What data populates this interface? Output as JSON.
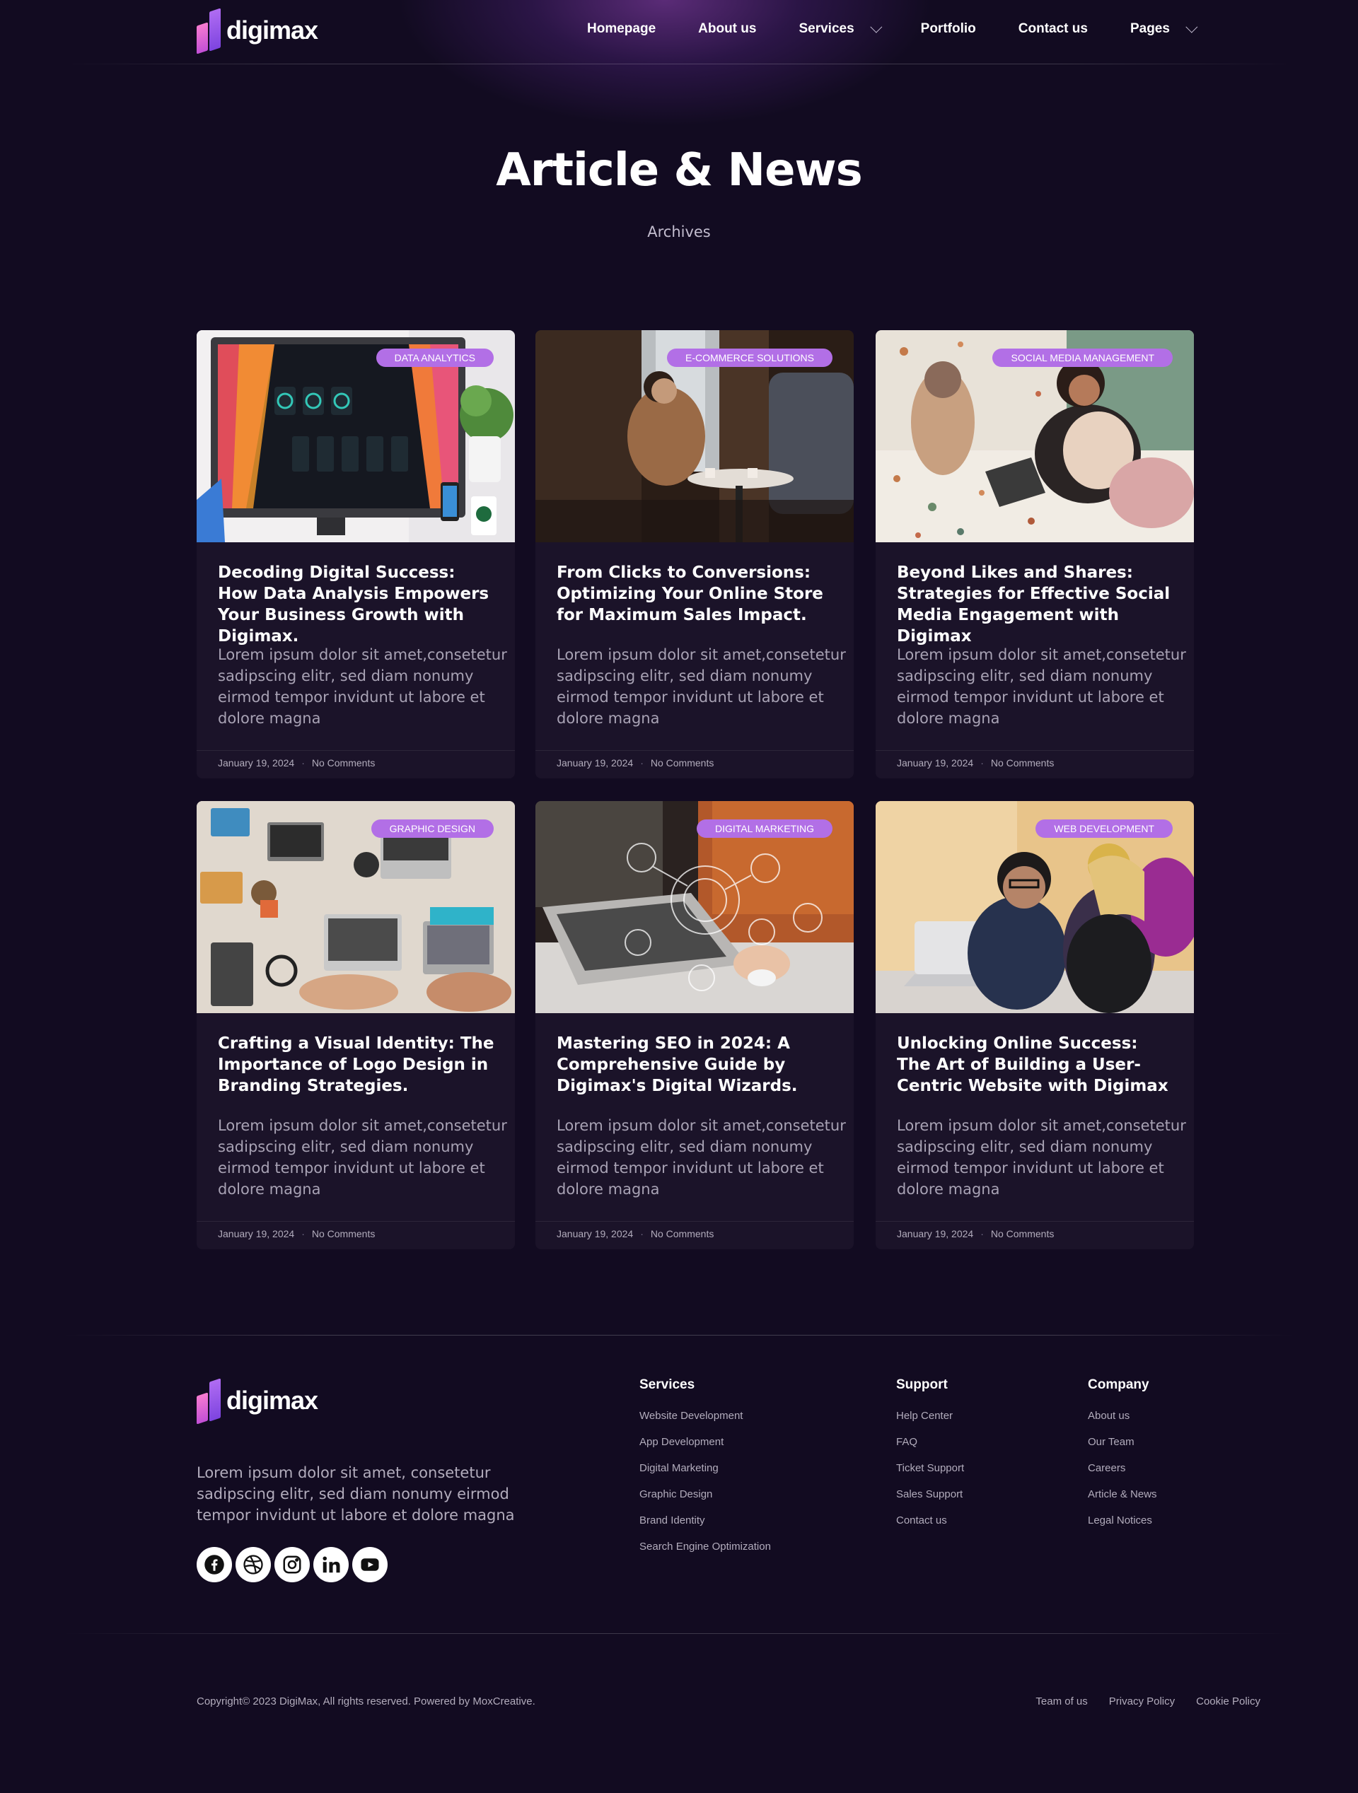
{
  "brand": {
    "name": "digimax"
  },
  "nav": {
    "items": [
      {
        "label": "Homepage",
        "has_dropdown": false
      },
      {
        "label": "About us",
        "has_dropdown": false
      },
      {
        "label": "Services",
        "has_dropdown": true
      },
      {
        "label": "Portfolio",
        "has_dropdown": false
      },
      {
        "label": "Contact us",
        "has_dropdown": false
      },
      {
        "label": "Pages",
        "has_dropdown": true
      }
    ]
  },
  "hero": {
    "title": "Article & News",
    "subtitle": "Archives"
  },
  "articles": [
    {
      "tag": "DATA ANALYTICS",
      "title": "Decoding Digital Success: How Data Analysis Empowers Your Business Growth with Digimax.",
      "excerpt": "Lorem ipsum dolor sit amet,consetetur sadipscing elitr, sed diam nonumy eirmod tempor invidunt ut labore et dolore magna",
      "date": "January 19, 2024",
      "comments": "No Comments",
      "image": "computer-monitor-dashboard-photo"
    },
    {
      "tag": "E-COMMERCE SOLUTIONS",
      "title": "From Clicks to Conversions: Optimizing Your Online Store for Maximum Sales Impact.",
      "excerpt": "Lorem ipsum dolor sit amet,consetetur sadipscing elitr, sed diam nonumy eirmod tempor invidunt ut labore et dolore magna",
      "date": "January 19, 2024",
      "comments": "No Comments",
      "image": "woman-in-cafe-photo"
    },
    {
      "tag": "SOCIAL MEDIA MANAGEMENT",
      "title": "Beyond Likes and Shares: Strategies for Effective Social Media Engagement with Digimax",
      "excerpt": "Lorem ipsum dolor sit amet,consetetur sadipscing elitr, sed diam nonumy eirmod tempor invidunt ut labore et dolore magna",
      "date": "January 19, 2024",
      "comments": "No Comments",
      "image": "women-working-laptop-photo"
    },
    {
      "tag": "GRAPHIC DESIGN",
      "title": "Crafting a Visual Identity: The Importance of Logo Design in Branding Strategies.",
      "excerpt": "Lorem ipsum dolor sit amet,consetetur sadipscing elitr, sed diam nonumy eirmod tempor invidunt ut labore et dolore magna",
      "date": "January 19, 2024",
      "comments": "No Comments",
      "image": "desk-with-laptops-photo"
    },
    {
      "tag": "DIGITAL MARKETING",
      "title": "Mastering SEO in 2024: A Comprehensive Guide by Digimax's Digital Wizards.",
      "excerpt": "Lorem ipsum dolor sit amet,consetetur sadipscing elitr, sed diam nonumy eirmod tempor invidunt ut labore et dolore magna",
      "date": "January 19, 2024",
      "comments": "No Comments",
      "image": "laptop-with-network-icons-photo"
    },
    {
      "tag": "WEB DEVELOPMENT",
      "title": "Unlocking Online Success: The Art of Building a User-Centric Website with Digimax",
      "excerpt": "Lorem ipsum dolor sit amet,consetetur sadipscing elitr, sed diam nonumy eirmod tempor invidunt ut labore et dolore magna",
      "date": "January 19, 2024",
      "comments": "No Comments",
      "image": "team-around-laptop-photo"
    }
  ],
  "footer": {
    "description": "Lorem ipsum dolor sit amet, consetetur sadipscing elitr, sed diam nonumy eirmod tempor invidunt ut labore et dolore magna",
    "socials": [
      "facebook-icon",
      "dribbble-icon",
      "instagram-icon",
      "linkedin-icon",
      "youtube-icon"
    ],
    "columns": [
      {
        "title": "Services",
        "links": [
          "Website Development",
          "App Development",
          "Digital Marketing",
          "Graphic Design",
          "Brand Identity",
          "Search Engine Optimization"
        ]
      },
      {
        "title": "Support",
        "links": [
          "Help Center",
          "FAQ",
          "Ticket Support",
          "Sales Support",
          "Contact us"
        ]
      },
      {
        "title": "Company",
        "links": [
          "About us",
          "Our Team",
          "Careers",
          "Article & News",
          "Legal Notices"
        ]
      }
    ],
    "copyright": "Copyright© 2023 DigiMax, All rights reserved. Powered by MoxCreative.",
    "bottom_links": [
      "Team of us",
      "Privacy Policy",
      "Cookie Policy"
    ]
  },
  "colors": {
    "background": "#120b21",
    "card": "#1b1329",
    "tag": "#b26fe6",
    "accent_pink": "#f77bd0",
    "accent_purple": "#7d44e0"
  }
}
